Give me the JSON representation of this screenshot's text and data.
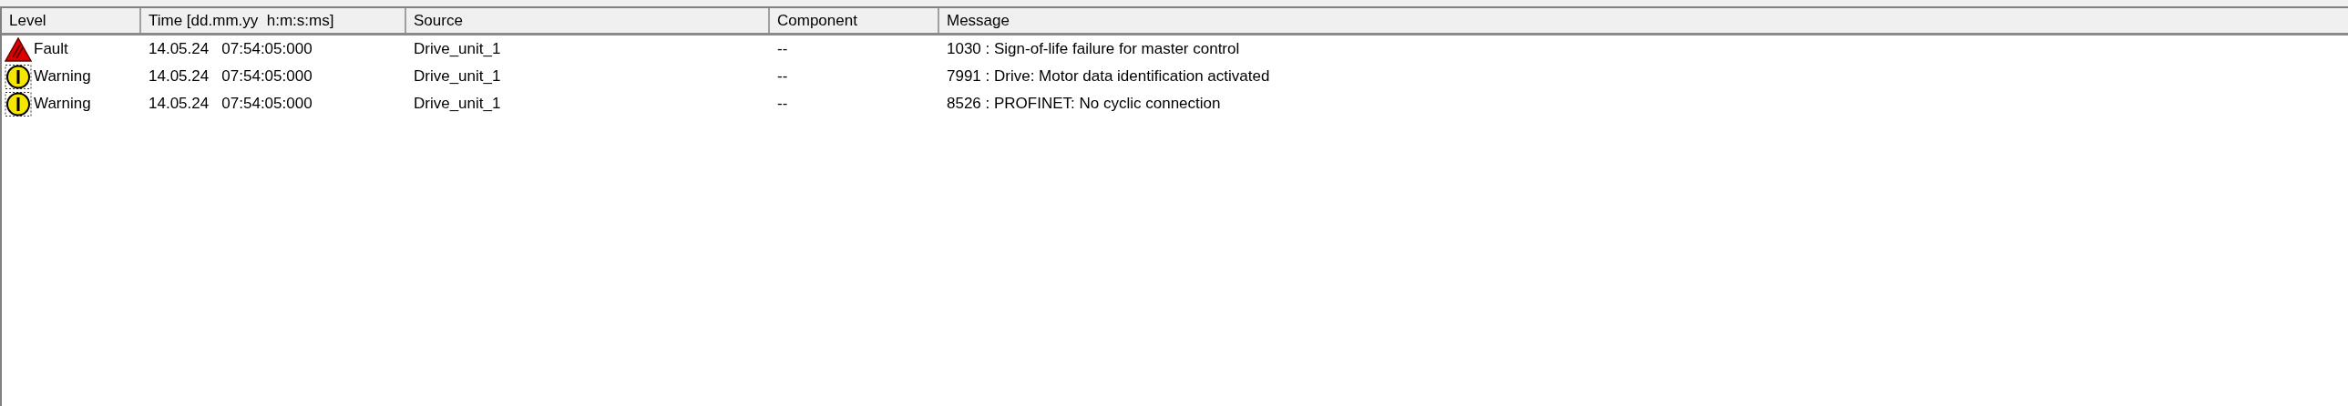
{
  "table": {
    "columns": [
      "Level",
      "Time [dd.mm.yy  h:m:s:ms]",
      "Source",
      "Component",
      "Message"
    ],
    "rows": [
      {
        "kind": "fault",
        "level": "Fault",
        "time": "14.05.24   07:54:05:000",
        "source": "Drive_unit_1",
        "component": "--",
        "message": "1030 : Sign-of-life failure for master control"
      },
      {
        "kind": "warning",
        "level": "Warning",
        "time": "14.05.24   07:54:05:000",
        "source": "Drive_unit_1",
        "component": "--",
        "message": "7991 : Drive: Motor data identification activated"
      },
      {
        "kind": "warning",
        "level": "Warning",
        "time": "14.05.24   07:54:05:000",
        "source": "Drive_unit_1",
        "component": "--",
        "message": "8526 : PROFINET: No cyclic connection"
      }
    ]
  }
}
